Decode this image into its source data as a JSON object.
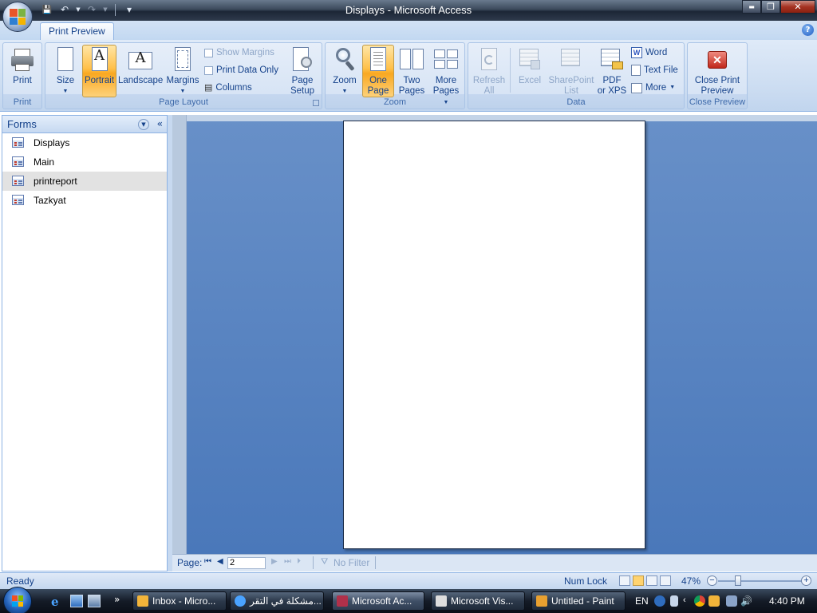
{
  "window": {
    "title": "Displays - Microsoft Access",
    "qat": {
      "save": "💾",
      "undo": "↶",
      "redo": "↷",
      "customize": "▾"
    },
    "controls": {
      "minimize": "▬",
      "restore": "❐",
      "close": "✕"
    }
  },
  "ribbon": {
    "tab_label": "Print Preview",
    "help": "?",
    "groups": {
      "print": {
        "label": "Print",
        "print_button": "Print"
      },
      "page_layout": {
        "label": "Page Layout",
        "size": "Size",
        "portrait": "Portrait",
        "landscape": "Landscape",
        "margins": "Margins",
        "show_margins": "Show Margins",
        "print_data_only": "Print Data Only",
        "columns": "Columns",
        "page_setup_line1": "Page",
        "page_setup_line2": "Setup"
      },
      "zoom": {
        "label": "Zoom",
        "zoom": "Zoom",
        "one_page_line1": "One",
        "one_page_line2": "Page",
        "two_pages_line1": "Two",
        "two_pages_line2": "Pages",
        "more_pages_line1": "More",
        "more_pages_line2": "Pages"
      },
      "data": {
        "label": "Data",
        "refresh_line1": "Refresh",
        "refresh_line2": "All",
        "excel": "Excel",
        "sharepoint_line1": "SharePoint",
        "sharepoint_line2": "List",
        "pdf_line1": "PDF",
        "pdf_line2": "or XPS",
        "word": "Word",
        "text_file": "Text File",
        "more": "More"
      },
      "close_preview": {
        "label": "Close Preview",
        "close_line1": "Close Print",
        "close_line2": "Preview"
      }
    }
  },
  "navigation": {
    "title": "Forms",
    "items": [
      {
        "label": "Displays"
      },
      {
        "label": "Main"
      },
      {
        "label": "printreport"
      },
      {
        "label": "Tazkyat"
      }
    ]
  },
  "record_bar": {
    "page_label": "Page:",
    "page_value": "2",
    "no_filter": "No Filter"
  },
  "status": {
    "ready": "Ready",
    "num_lock": "Num Lock",
    "zoom": "47%"
  },
  "taskbar": {
    "tasks": [
      {
        "label": "Inbox - Micro..."
      },
      {
        "label": "مشكلة في التقر..."
      },
      {
        "label": "Microsoft Ac..."
      },
      {
        "label": "Microsoft Vis..."
      },
      {
        "label": "Untitled - Paint"
      }
    ],
    "language": "EN",
    "time": "4:40 PM",
    "more": "»"
  },
  "colors": {
    "accent": "#15428b",
    "active_button": "#ffc04a",
    "preview_background": "#5882c0"
  }
}
